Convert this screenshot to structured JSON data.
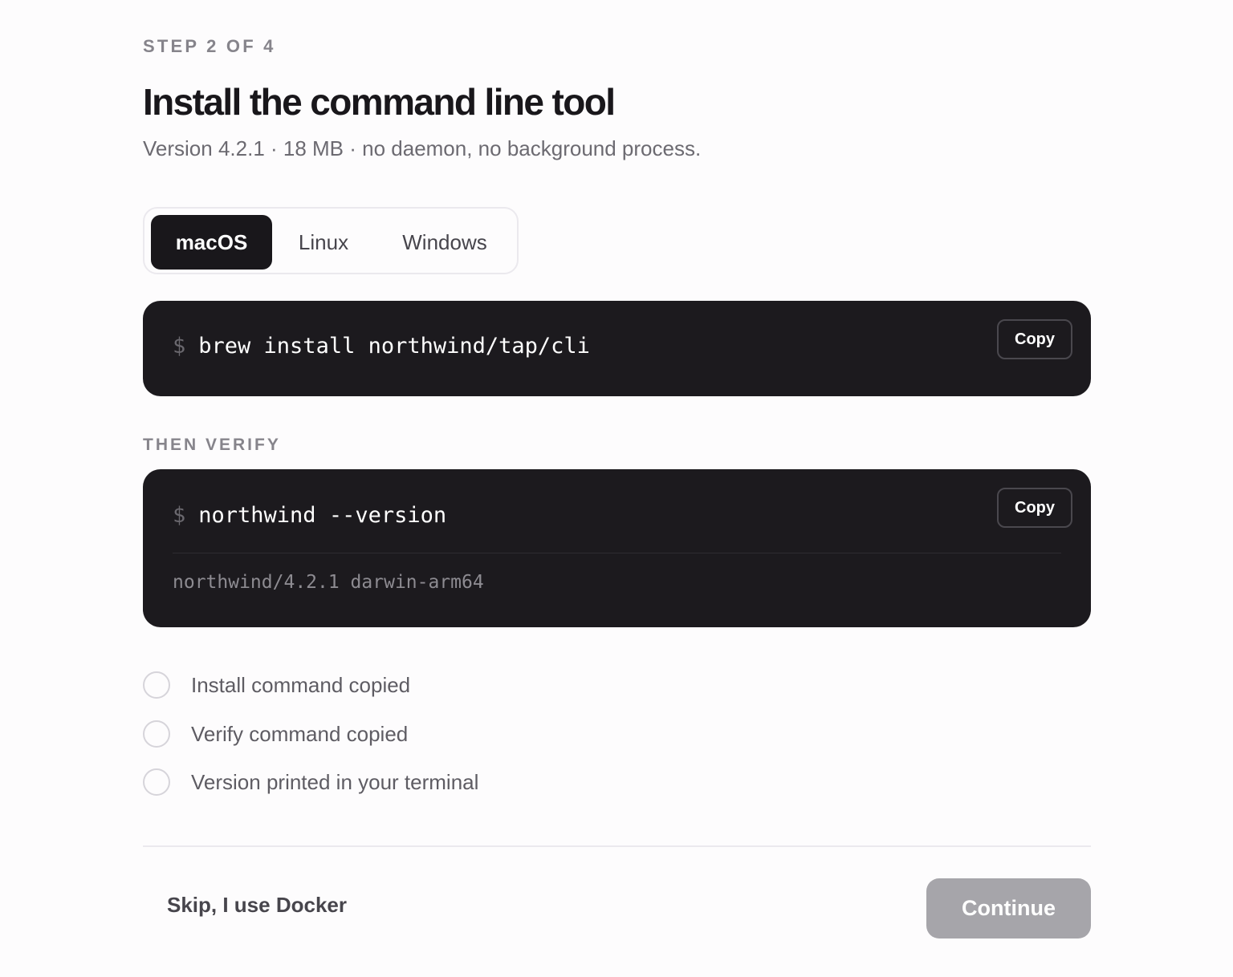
{
  "header": {
    "step": "STEP 2 OF 4",
    "title": "Install the command line tool",
    "subtitle": "Version 4.2.1 · 18 MB · no daemon, no background process."
  },
  "os_tabs": {
    "selected": "macOS",
    "items": [
      {
        "label": "macOS",
        "selected": true
      },
      {
        "label": "Linux",
        "selected": false
      },
      {
        "label": "Windows",
        "selected": false
      }
    ]
  },
  "install_block": {
    "prompt": "$",
    "command": "brew install northwind/tap/cli",
    "copy_label": "Copy"
  },
  "verify_section": {
    "label": "THEN VERIFY",
    "prompt": "$",
    "command": "northwind --version",
    "output": "northwind/4.2.1 darwin-arm64",
    "copy_label": "Copy"
  },
  "checklist": [
    {
      "label": "Install command copied",
      "checked": false
    },
    {
      "label": "Verify command copied",
      "checked": false
    },
    {
      "label": "Version printed in your terminal",
      "checked": false
    }
  ],
  "footer": {
    "skip_label": "Skip, I use Docker",
    "continue_label": "Continue",
    "continue_enabled": false
  },
  "colors": {
    "background": "#fdfcfd",
    "code_background": "#1c1a1e",
    "active_tab": "#19171b",
    "disabled_button": "#a6a5aa",
    "muted_text": "#86848b"
  }
}
